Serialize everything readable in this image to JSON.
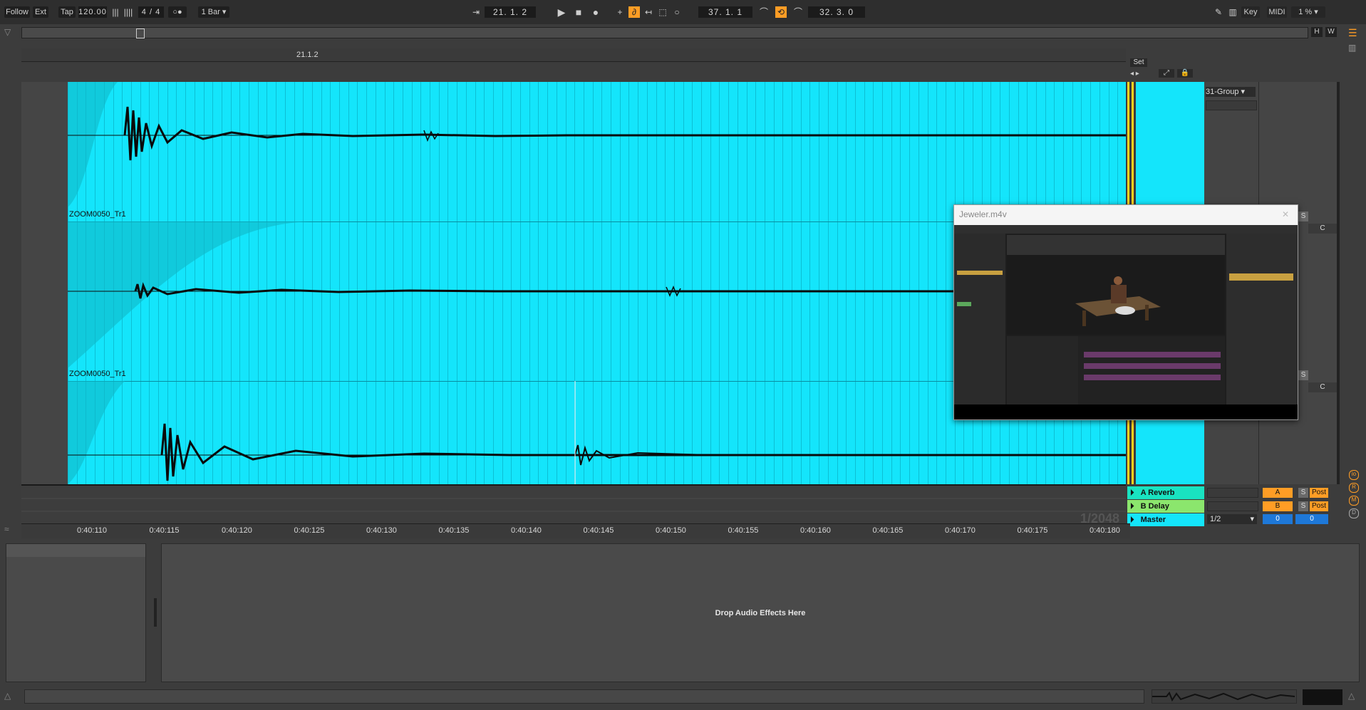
{
  "topbar": {
    "follow": "Follow",
    "ext": "Ext",
    "tap": "Tap",
    "tempo": "120.00",
    "time_signature": "4 / 4",
    "quantize": "1 Bar",
    "position": "21.  1.  2",
    "loop_start": "37.  1.  1",
    "loop_length": "32.  3.  0",
    "key": "Key",
    "midi": "MIDI",
    "cpu": "1 %"
  },
  "overview": {
    "h_label": "H",
    "w_label": "W"
  },
  "ruler_top": {
    "marker": "21.1.2",
    "set_label": "Set"
  },
  "tracks": [
    {
      "clip_name": ""
    },
    {
      "clip_name": "ZOOM0050_Tr1"
    },
    {
      "clip_name": "ZOOM0050_Tr1"
    }
  ],
  "mixer": {
    "group_select": "31-Group",
    "returns": [
      {
        "name": "A Reverb",
        "color": "#19e3c1",
        "send_letter": "A",
        "solo": "S",
        "post": "Post"
      },
      {
        "name": "B Delay",
        "color": "#8be66d",
        "send_letter": "B",
        "solo": "S",
        "post": "Post"
      },
      {
        "name": "Master",
        "color": "#14e5fb",
        "select": "1/2",
        "vol_a": "0",
        "vol_b": "0"
      }
    ],
    "solo_label": "S",
    "c_label": "C",
    "zoom_fraction": "1/2048"
  },
  "time_ruler": [
    "0:40:110",
    "0:40:115",
    "0:40:120",
    "0:40:125",
    "0:40:130",
    "0:40:135",
    "0:40:140",
    "0:40:145",
    "0:40:150",
    "0:40:155",
    "0:40:160",
    "0:40:165",
    "0:40:170",
    "0:40:175",
    "0:40:180"
  ],
  "device_area": {
    "drop_hint": "Drop Audio Effects Here"
  },
  "video_window": {
    "title": "Jeweler.m4v"
  },
  "colors": {
    "clip": "#14e5fb",
    "accent": "#ff9d25",
    "loop_bar": "#ffd21f"
  }
}
